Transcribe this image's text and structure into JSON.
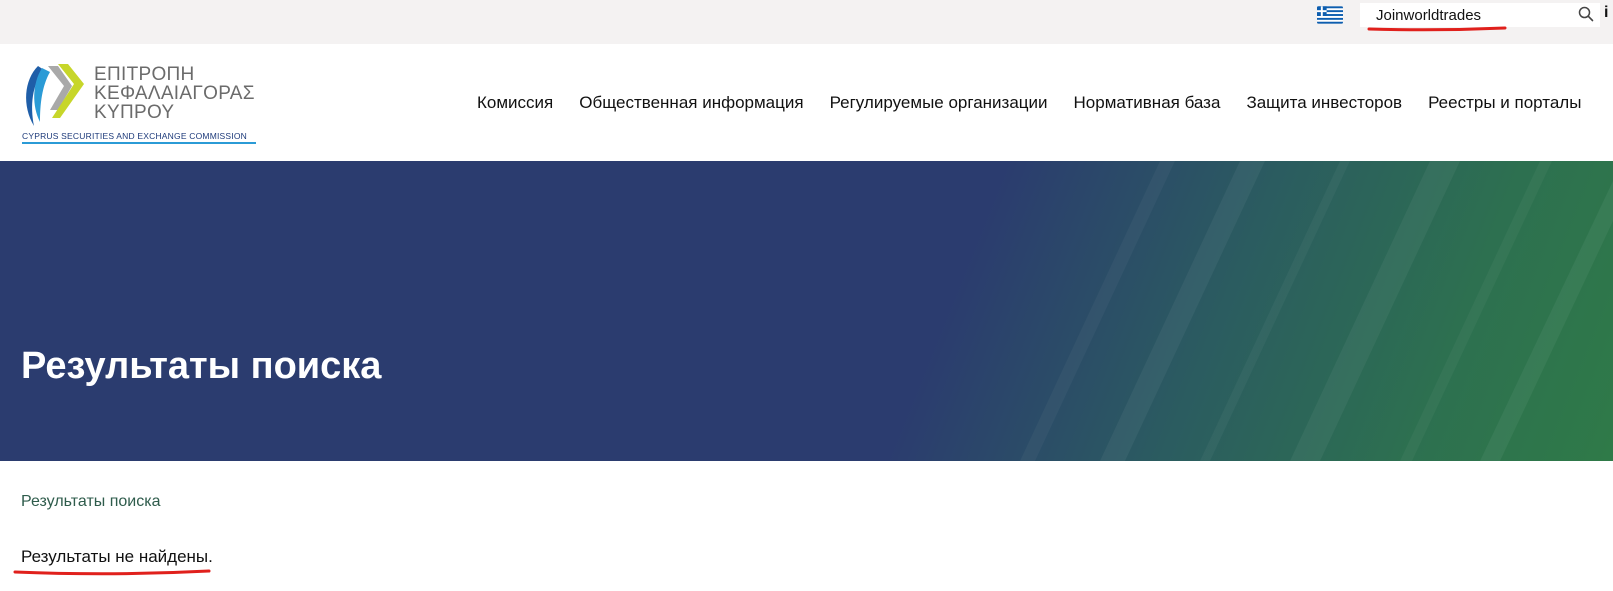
{
  "topbar": {
    "language_flag_icon": "greek-flag-icon",
    "search": {
      "value": "Joinworldtrades",
      "placeholder": "",
      "icon": "search-icon"
    },
    "edge_icon_char": "i"
  },
  "header": {
    "logo": {
      "line1": "ΕΠΙΤΡΟΠΗ",
      "line2": "ΚΕΦΑΛΑΙΑΓΟΡΑΣ",
      "line3": "ΚΥΠΡΟΥ",
      "subtitle": "CYPRUS SECURITIES AND EXCHANGE COMMISSION"
    },
    "nav": [
      {
        "label": "Комиссия"
      },
      {
        "label": "Общественная информация"
      },
      {
        "label": "Регулируемые организации"
      },
      {
        "label": "Нормативная база"
      },
      {
        "label": "Защита инвесторов"
      },
      {
        "label": "Реестры и порталы"
      }
    ]
  },
  "hero": {
    "title": "Результаты поиска"
  },
  "content": {
    "breadcrumb": "Результаты поиска",
    "message": "Результаты не найдены."
  },
  "colors": {
    "hero_blue": "#2b3c6f",
    "hero_green": "#2f7a48",
    "annotation_red": "#e0201c",
    "topbar_bg": "#f4f2f2"
  }
}
